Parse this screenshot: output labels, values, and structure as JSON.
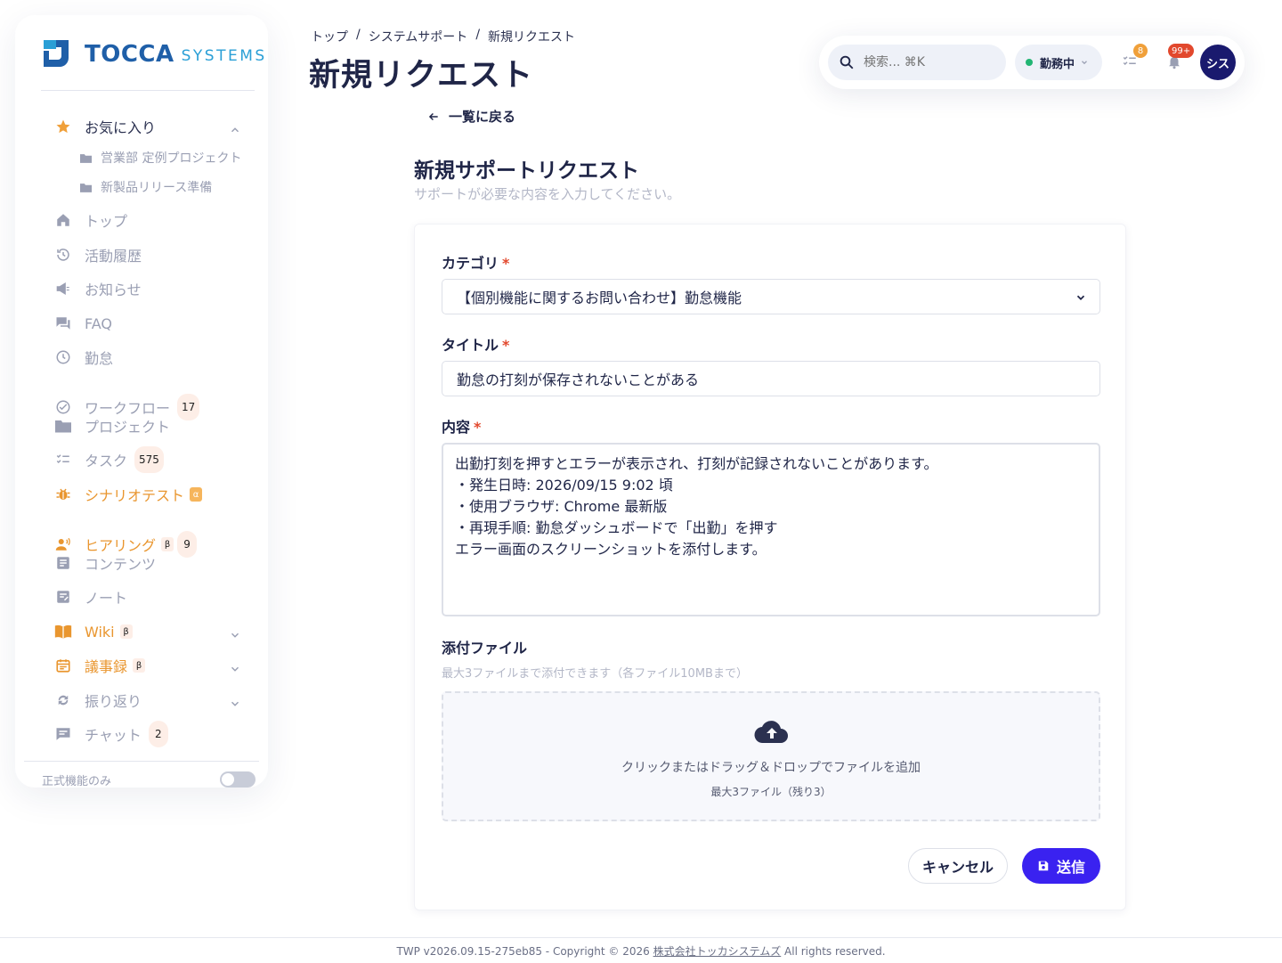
{
  "brand": {
    "word1": "TOCCA",
    "word2": "SYSTEMS"
  },
  "sidebar": {
    "favorites": {
      "label": "お気に入り",
      "items": [
        {
          "label": "営業部 定例プロジェクト"
        },
        {
          "label": "新製品リリース準備"
        }
      ]
    },
    "items": [
      {
        "label": "トップ"
      },
      {
        "label": "活動履歴"
      },
      {
        "label": "お知らせ"
      },
      {
        "label": "FAQ"
      },
      {
        "label": "勤怠"
      },
      {
        "label": "ワークフロー",
        "badge": "17"
      },
      {
        "label": "プロジェクト"
      },
      {
        "label": "タスク",
        "badge": "575"
      },
      {
        "label": "シナリオテスト",
        "tag": "α"
      },
      {
        "label": "ヒアリング",
        "tag": "β",
        "badge": "9"
      },
      {
        "label": "コンテンツ"
      },
      {
        "label": "ノート"
      },
      {
        "label": "Wiki",
        "tag": "β"
      },
      {
        "label": "議事録",
        "tag": "β"
      },
      {
        "label": "振り返り"
      },
      {
        "label": "チャット",
        "badge": "2"
      }
    ],
    "footer_toggle_label": "正式機能のみ"
  },
  "header": {
    "breadcrumb": [
      "トップ",
      "/",
      "システムサポート",
      "/",
      "新規リクエスト"
    ],
    "title": "新規リクエスト",
    "search_placeholder": "検索... ⌘K",
    "status_label": "勤務中",
    "tasks_count": "8",
    "notifications_count": "99+",
    "avatar_label": "シス"
  },
  "main": {
    "back_label": "一覧に戻る",
    "form_title": "新規サポートリクエスト",
    "form_subtitle": "サポートが必要な内容を入力してください。",
    "category": {
      "label": "カテゴリ",
      "required": "*",
      "value": "【個別機能に関するお問い合わせ】勤怠機能"
    },
    "title_field": {
      "label": "タイトル",
      "required": "*",
      "value": "勤怠の打刻が保存されないことがある"
    },
    "content": {
      "label": "内容",
      "required": "*",
      "value": "出勤打刻を押すとエラーが表示され、打刻が記録されないことがあります。\n・発生日時: 2026/09/15 9:02 頃\n・使用ブラウザ: Chrome 最新版\n・再現手順: 勤怠ダッシュボードで「出勤」を押す\nエラー画面のスクリーンショットを添付します。"
    },
    "attachments": {
      "label": "添付ファイル",
      "hint": "最大3ファイルまで添付できます（各ファイル10MBまで）",
      "drop_text": "クリックまたはドラッグ＆ドロップでファイルを追加",
      "drop_sub": "最大3ファイル（残り3）"
    },
    "cancel_label": "キャンセル",
    "submit_label": "送信"
  },
  "footer": {
    "prefix": "TWP v2026.09.15-275eb85 - Copyright © 2026 ",
    "company": "株式会社トッカシステムズ",
    "suffix": " All rights reserved."
  },
  "colors": {
    "accent": "#3a22f0",
    "brand": "#1f5fa8",
    "orange": "#e9962f",
    "status_green": "#22b573"
  }
}
